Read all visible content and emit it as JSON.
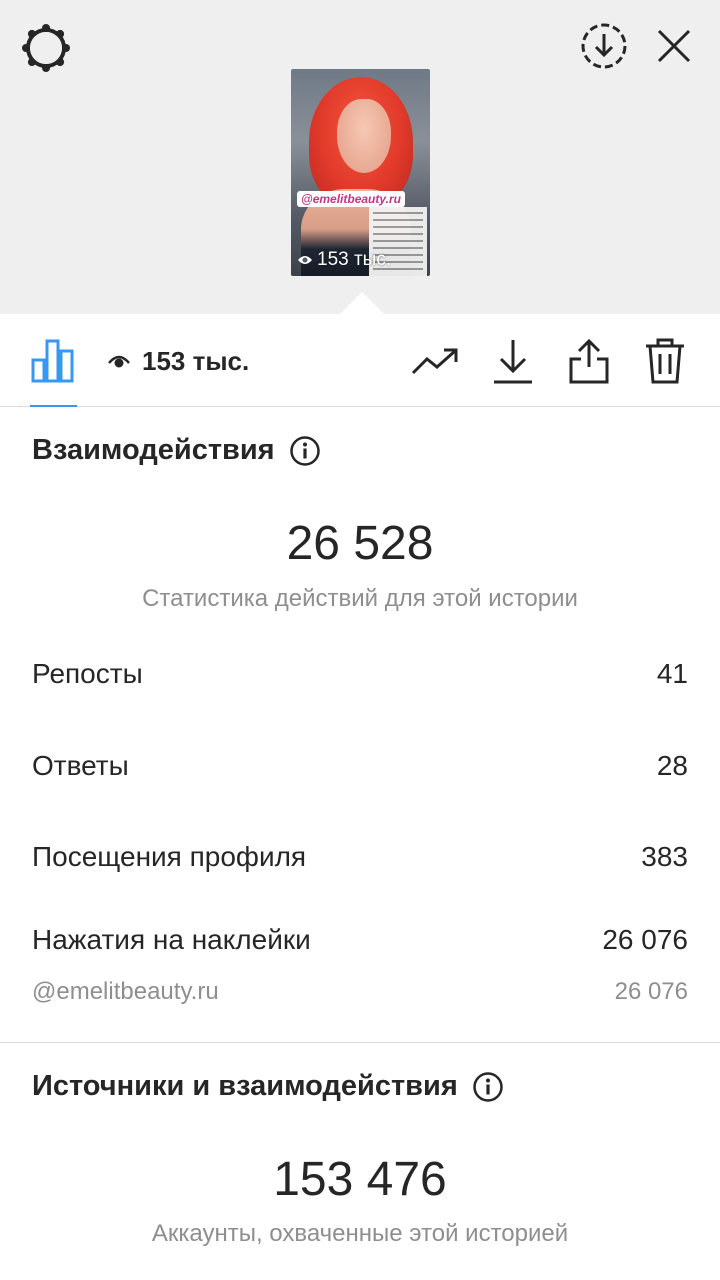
{
  "header": {
    "icons": [
      "settings-icon",
      "save-to-archive-icon",
      "close-icon"
    ]
  },
  "story_preview": {
    "sticker_text": "@emelitbeauty.ru",
    "views_text": "153 тыс."
  },
  "tabbar": {
    "views_count": "153 тыс.",
    "icons": [
      "insights-icon",
      "eye-icon",
      "promote-icon",
      "download-icon",
      "share-icon",
      "delete-icon"
    ],
    "active_tab_color": "#3897f0"
  },
  "interactions": {
    "title": "Взаимодействия",
    "total": "26 528",
    "caption": "Статистика действий для этой истории",
    "rows": [
      {
        "label": "Репосты",
        "value": "41"
      },
      {
        "label": "Ответы",
        "value": "28"
      },
      {
        "label": "Посещения профиля",
        "value": "383"
      },
      {
        "label": "Нажатия на наклейки",
        "value": "26 076"
      }
    ],
    "sticker_row": {
      "label": "@emelitbeauty.ru",
      "value": "26 076"
    }
  },
  "discovery": {
    "title": "Источники и взаимодействия",
    "total": "153 476",
    "caption": "Аккаунты, охваченные этой историей"
  }
}
